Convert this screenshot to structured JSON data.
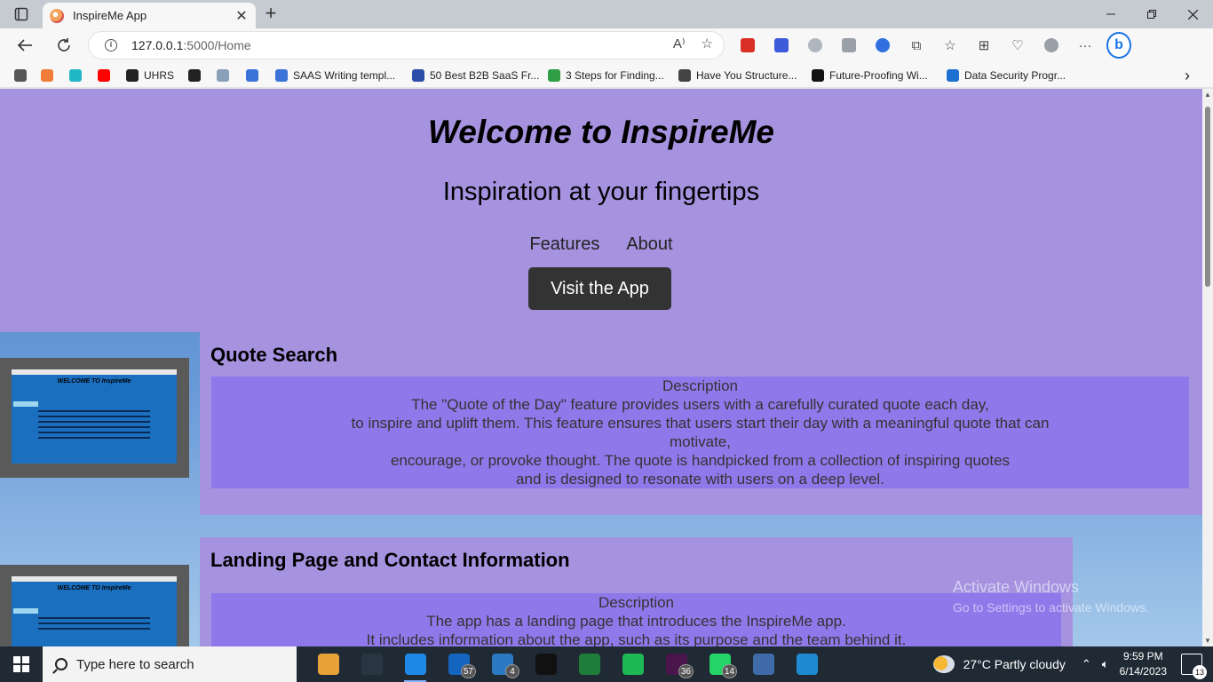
{
  "browser": {
    "tab_title": "InspireMe App",
    "url_host": "127.0.0.1",
    "url_path": ":5000/Home",
    "read_aloud_icon": "A⁾",
    "bookmarks": [
      {
        "label": "",
        "icon": "page-icon",
        "color": "#555555"
      },
      {
        "label": "",
        "icon": "brave-icon",
        "color": "#f07c3a"
      },
      {
        "label": "",
        "icon": "tk-icon",
        "color": "#20b7c6"
      },
      {
        "label": "",
        "icon": "youtube-icon",
        "color": "#ff0000"
      },
      {
        "label": "UHRS",
        "icon": "uhrs-icon",
        "color": "#222222"
      },
      {
        "label": "",
        "icon": "sk-icon",
        "color": "#222222"
      },
      {
        "label": "",
        "icon": "cloud-icon",
        "color": "#8aa0b8"
      },
      {
        "label": "",
        "icon": "search-icon",
        "color": "#3b73d9"
      },
      {
        "label": "SAAS Writing templ...",
        "icon": "search-icon",
        "color": "#3b73d9"
      },
      {
        "label": "50 Best B2B SaaS Fr...",
        "icon": "bookmark-icon",
        "color": "#2d4ea8"
      },
      {
        "label": "3 Steps for Finding...",
        "icon": "leaf-icon",
        "color": "#2f9e44"
      },
      {
        "label": "Have You Structure...",
        "icon": "secb-icon",
        "color": "#444444"
      },
      {
        "label": "Future-Proofing Wi...",
        "icon": "spark-icon",
        "color": "#111111"
      },
      {
        "label": "Data Security Progr...",
        "icon": "globe-icon",
        "color": "#1d6fd1"
      }
    ]
  },
  "page": {
    "hero_title": "Welcome to InspireMe",
    "hero_subtitle": "Inspiration at your fingertips",
    "nav_links": [
      "Features",
      "About"
    ],
    "cta_label": "Visit the App",
    "thumb_title": "WELCOME TO InspireMe",
    "features": [
      {
        "title": "Quote Search",
        "desc_heading": "Description",
        "desc_lines": [
          "The \"Quote of the Day\" feature provides users with a carefully curated quote each day,",
          "to inspire and uplift them. This feature ensures that users start their day with a meaningful quote that can",
          "motivate,",
          "encourage, or provoke thought. The quote is handpicked from a collection of inspiring quotes",
          "and is designed to resonate with users on a deep level."
        ]
      },
      {
        "title": "Landing Page and Contact Information",
        "desc_heading": "Description",
        "desc_lines": [
          "The app has a landing page that introduces the InspireMe app.",
          "It includes information about the app, such as its purpose and the team behind it."
        ]
      }
    ],
    "watermark_title": "Activate Windows",
    "watermark_sub": "Go to Settings to activate Windows."
  },
  "taskbar": {
    "search_placeholder": "Type here to search",
    "apps": [
      {
        "name": "search-highlight-icon",
        "color": "#e8a23a",
        "badge": ""
      },
      {
        "name": "task-view-icon",
        "color": "#2a3542",
        "badge": ""
      },
      {
        "name": "edge-icon",
        "color": "#1e88e5",
        "badge": ""
      },
      {
        "name": "mail-icon",
        "color": "#1565c0",
        "badge": "57"
      },
      {
        "name": "teams-files-icon",
        "color": "#2b79c2",
        "badge": "4"
      },
      {
        "name": "tiktok-icon",
        "color": "#111111",
        "badge": ""
      },
      {
        "name": "grid-app-icon",
        "color": "#1e7d3a",
        "badge": ""
      },
      {
        "name": "spotify-icon",
        "color": "#1db954",
        "badge": ""
      },
      {
        "name": "slack-icon",
        "color": "#4a154b",
        "badge": "36"
      },
      {
        "name": "whatsapp-icon",
        "color": "#25d366",
        "badge": "14"
      },
      {
        "name": "control-panel-icon",
        "color": "#3f6ba8",
        "badge": ""
      },
      {
        "name": "vscode-icon",
        "color": "#1f8ad2",
        "badge": ""
      }
    ],
    "weather": "27°C  Partly cloudy",
    "time": "9:59 PM",
    "date": "6/14/2023",
    "notifications": "13"
  }
}
